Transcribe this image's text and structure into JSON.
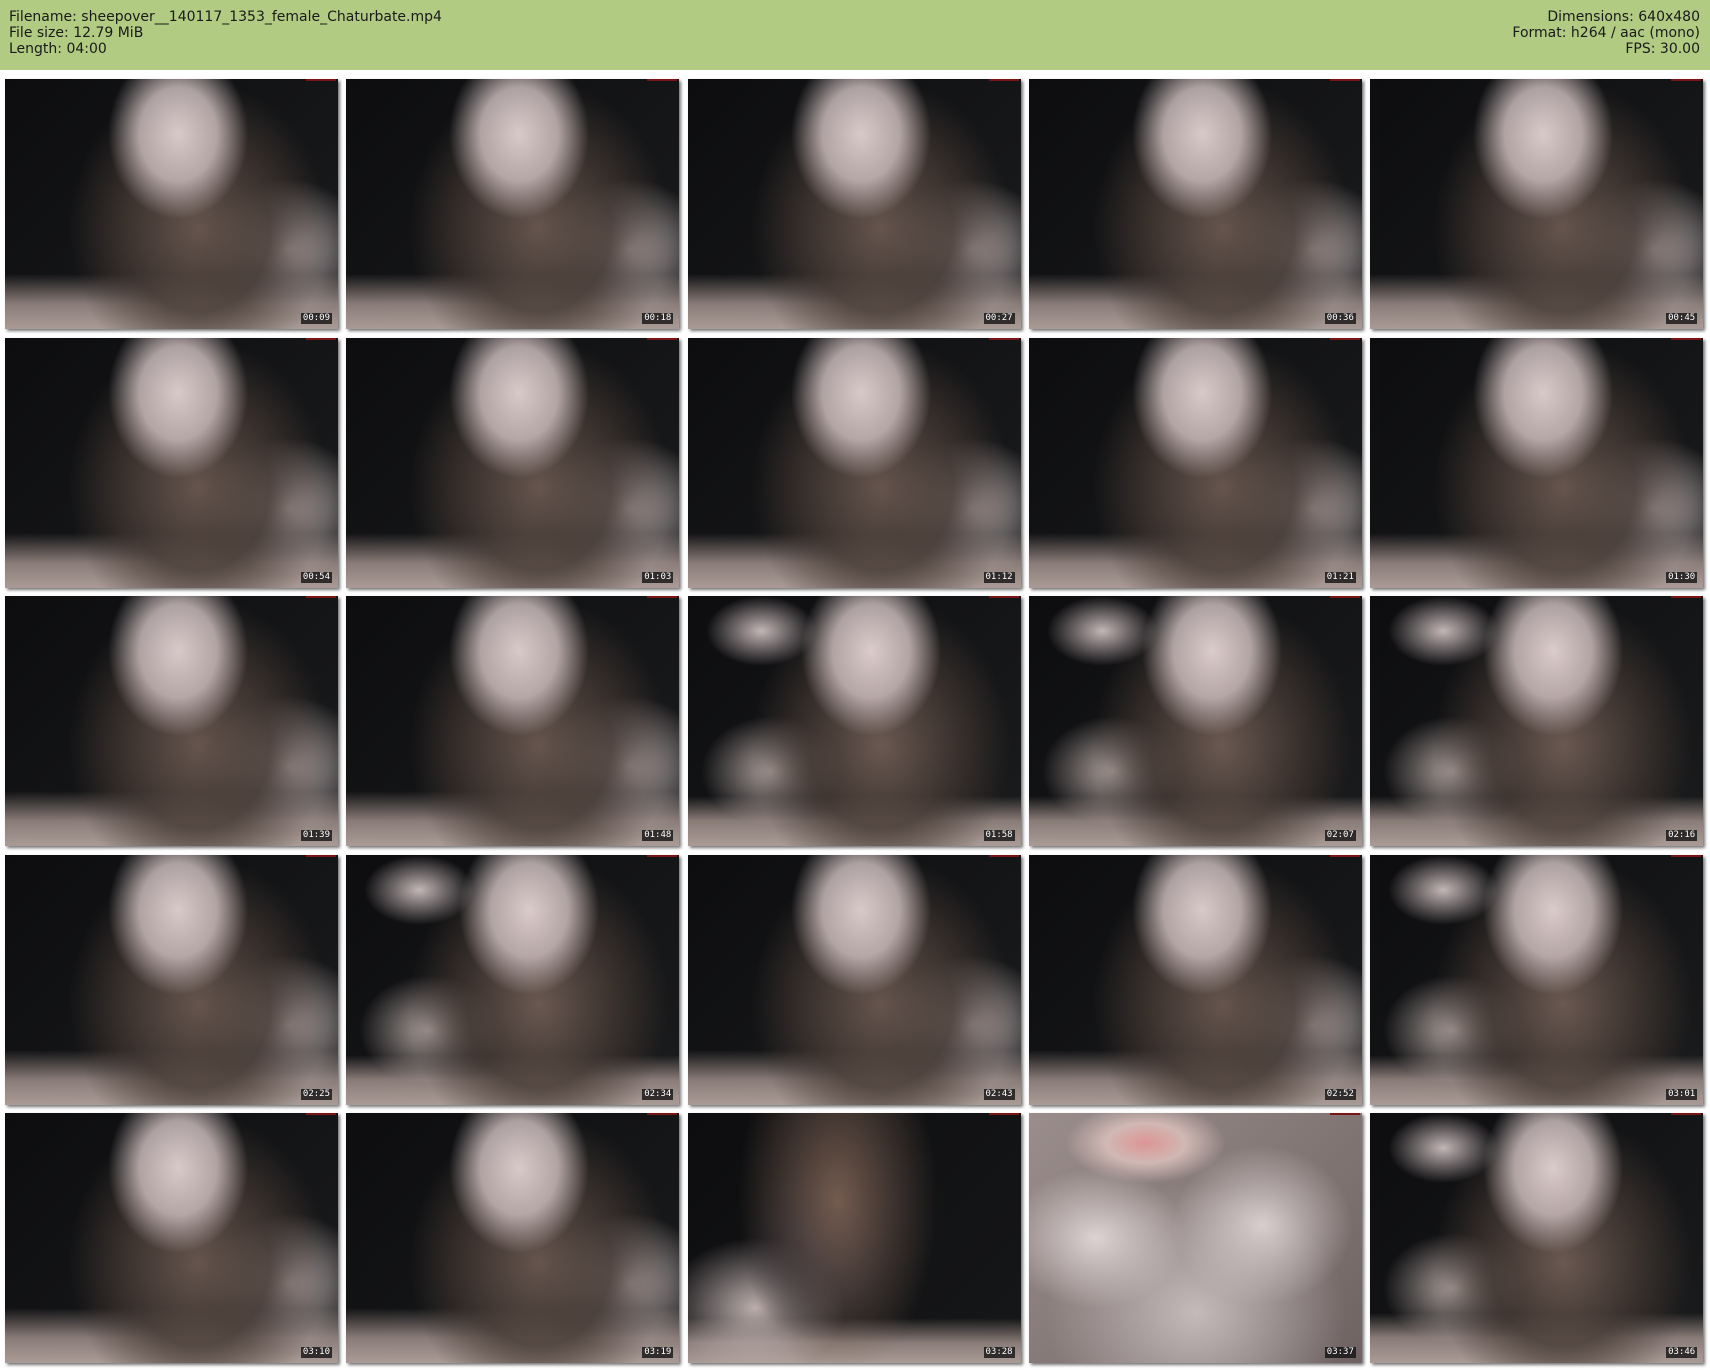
{
  "header": {
    "left": [
      "Filename: sheepover__140117_1353_female_Chaturbate.mp4",
      "File size: 12.79 MiB",
      "Length: 04:00"
    ],
    "right": [
      "Dimensions: 640x480",
      "Format: h264 / aac (mono)",
      "FPS: 30.00"
    ],
    "background_color": "#b1cb83"
  },
  "thumbnails": [
    {
      "timestamp": "00:09",
      "pose": "a"
    },
    {
      "timestamp": "00:18",
      "pose": "a"
    },
    {
      "timestamp": "00:27",
      "pose": "a"
    },
    {
      "timestamp": "00:36",
      "pose": "a"
    },
    {
      "timestamp": "00:45",
      "pose": "a"
    },
    {
      "timestamp": "00:54",
      "pose": "a"
    },
    {
      "timestamp": "01:03",
      "pose": "a"
    },
    {
      "timestamp": "01:12",
      "pose": "a"
    },
    {
      "timestamp": "01:21",
      "pose": "a"
    },
    {
      "timestamp": "01:30",
      "pose": "a"
    },
    {
      "timestamp": "01:39",
      "pose": "a"
    },
    {
      "timestamp": "01:48",
      "pose": "a"
    },
    {
      "timestamp": "01:58",
      "pose": "b"
    },
    {
      "timestamp": "02:07",
      "pose": "b"
    },
    {
      "timestamp": "02:16",
      "pose": "b"
    },
    {
      "timestamp": "02:25",
      "pose": "a"
    },
    {
      "timestamp": "02:34",
      "pose": "b"
    },
    {
      "timestamp": "02:43",
      "pose": "a"
    },
    {
      "timestamp": "02:52",
      "pose": "a"
    },
    {
      "timestamp": "03:01",
      "pose": "b"
    },
    {
      "timestamp": "03:10",
      "pose": "a"
    },
    {
      "timestamp": "03:19",
      "pose": "a"
    },
    {
      "timestamp": "03:28",
      "pose": "d"
    },
    {
      "timestamp": "03:37",
      "pose": "c"
    },
    {
      "timestamp": "03:46",
      "pose": "b"
    }
  ]
}
